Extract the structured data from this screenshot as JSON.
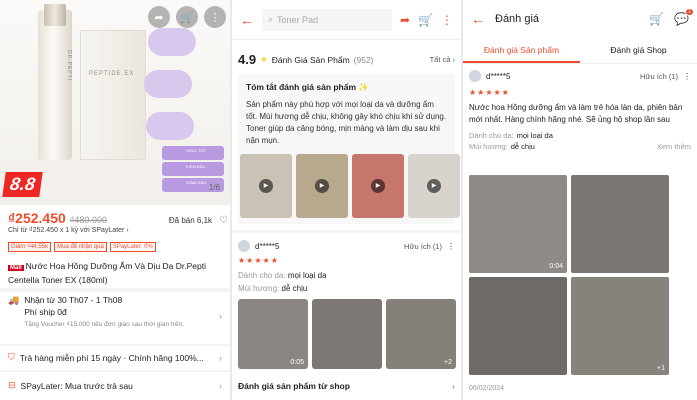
{
  "panel1": {
    "brand_vertical": "DR.PEPTI",
    "box_label": "PEPTIDE EX",
    "badges": [
      "HOLD TỐT",
      "KIỂM DẦU",
      "GIẢM GÁN"
    ],
    "image_counter": "1/6",
    "sale_badge": "8.8",
    "price": "₫252.450",
    "old_price": "₫480.000",
    "sold": "Đã bán 6,1k",
    "installment": "Chỉ từ ₫252.450 x 1 kỳ với SPayLater ›",
    "tags": [
      "Giảm ₫44,55k",
      "Mua để nhận quà",
      "SPayLater: 0%"
    ],
    "mall_badge": "Mall",
    "title": "Nước Hoa Hồng Dưỡng Ẩm Và Dịu Da Dr.Pepti Centella Toner EX (180ml)",
    "delivery": "Nhận từ 30 Th07 - 1 Th08",
    "shipping_fee": "Phí ship 0đ",
    "voucher_note": "Tặng Voucher ₫15.000 nếu đơn giao sau thời gian trên.",
    "return_policy": "Trả hàng miễn phí 15 ngày · Chính hãng 100%...",
    "spaylater": "SPayLater: Mua trước trả sau"
  },
  "panel2": {
    "search_placeholder": "Toner Pad",
    "score": "4.9",
    "ratings_label": "Đánh Giá Sản Phẩm",
    "ratings_count": "(952)",
    "see_all": "Tất cả ›",
    "ai_title": "Tóm tắt đánh giá sản phẩm ✨",
    "ai_text": "Sản phẩm này phù hợp với mọi loại da và dưỡng ẩm tốt. Mùi hương dễ chịu, không gây khó chịu khi sử dụng. Toner giúp da căng bóng, mịn màng và làm dịu sau khi nặn mụn.",
    "reviewer": "d*****5",
    "helpful": "Hữu ích (1)",
    "stars": "★★★★★",
    "skin_label": "Dành cho da:",
    "skin_value": "mọi loại da",
    "scent_label": "Mùi hương:",
    "scent_value": "dễ chịu",
    "duration": "0:05",
    "more_images": "+2",
    "shop_reviews": "Đánh giá sản phẩm từ shop"
  },
  "panel3": {
    "title": "Đánh giá",
    "notif_count": "1",
    "tab_product": "Đánh giá Sản phẩm",
    "tab_shop": "Đánh giá Shop",
    "reviewer": "d*****5",
    "helpful": "Hữu ích (1)",
    "stars": "★★★★★",
    "text": "Nước hoa Hồng dưỡng ẩm và làm trẻ hóa làn da, phiên bản mới nhất. Hàng chính hãng nhé. Sẽ ủng hộ shop lần sau",
    "skin_label": "Dành cho da:",
    "skin_value": "mọi loại da",
    "scent_label": "Mùi hương:",
    "scent_value": "dễ chịu",
    "see_more": "Xem thêm",
    "duration": "0:04",
    "more_images": "+1",
    "date": "06/02/2024"
  },
  "colors": {
    "accent": "#ee4d2d",
    "star": "#ffce3d",
    "mall": "#d0011b"
  }
}
